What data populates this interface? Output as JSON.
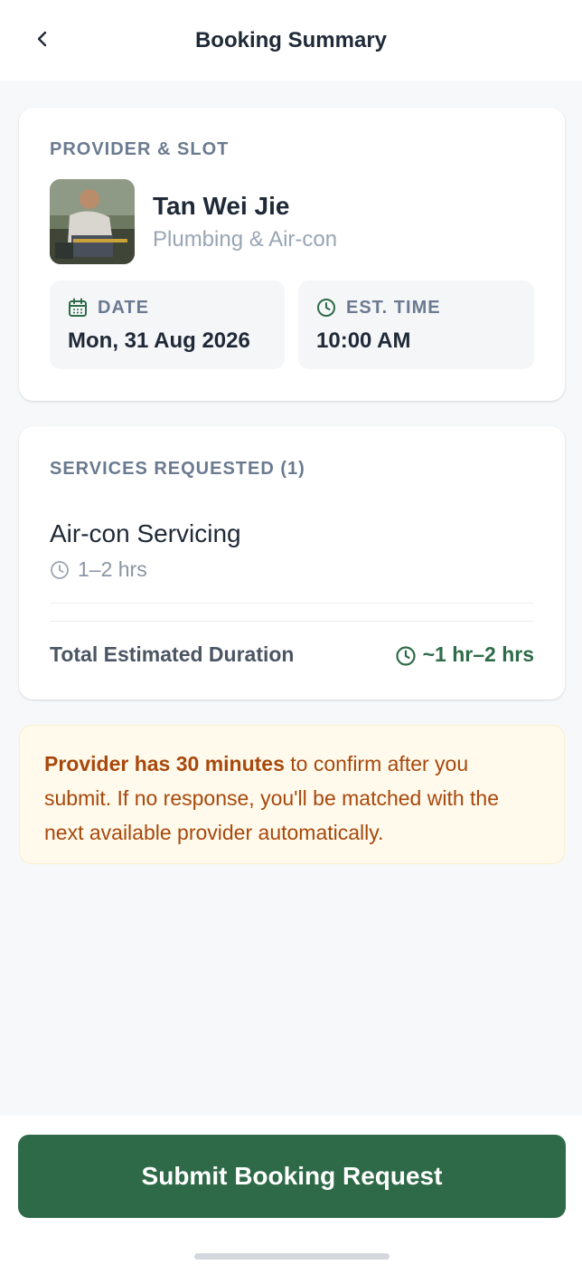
{
  "header": {
    "title": "Booking Summary",
    "back_icon": "chevron-left-icon"
  },
  "provider_card": {
    "section_label": "PROVIDER & SLOT",
    "provider_name": "Tan Wei Jie",
    "provider_category": "Plumbing & Air-con",
    "date_label": "DATE",
    "date_value": "Mon, 31 Aug 2026",
    "date_icon": "calendar-icon",
    "time_label": "EST. TIME",
    "time_value": "10:00 AM",
    "time_icon": "clock-icon"
  },
  "services_card": {
    "section_label": "SERVICES REQUESTED (1)",
    "services": [
      {
        "name": "Air-con Servicing",
        "duration": "1–2 hrs"
      }
    ],
    "total_label": "Total Estimated Duration",
    "total_value": "~1 hr–2 hrs"
  },
  "notice": {
    "bold_text": "Provider has 30 minutes",
    "rest_text": " to confirm after you submit. If no response, you'll be matched with the next available provider automatically."
  },
  "footer": {
    "submit_label": "Submit Booking Request"
  },
  "colors": {
    "accent": "#2e6a48",
    "notice_text": "#a8480c",
    "notice_bg": "#fffaeb",
    "label_gray": "#6b7a90"
  }
}
